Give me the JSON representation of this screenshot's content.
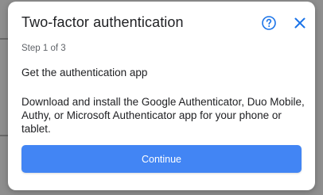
{
  "dialog": {
    "title": "Two-factor authentication",
    "step": "Step 1 of 3",
    "heading": "Get the authentication app",
    "body": "Download and install the Google Authenticator, Duo Mobile, Authy, or Microsoft Authenticator app for your phone or tablet.",
    "continue_label": "Continue",
    "icons": {
      "help": "help-circle-icon",
      "close": "close-icon"
    }
  },
  "colors": {
    "accent": "#4285f4",
    "icon_blue": "#1a73e8",
    "overlay": "#8e8e8e"
  }
}
